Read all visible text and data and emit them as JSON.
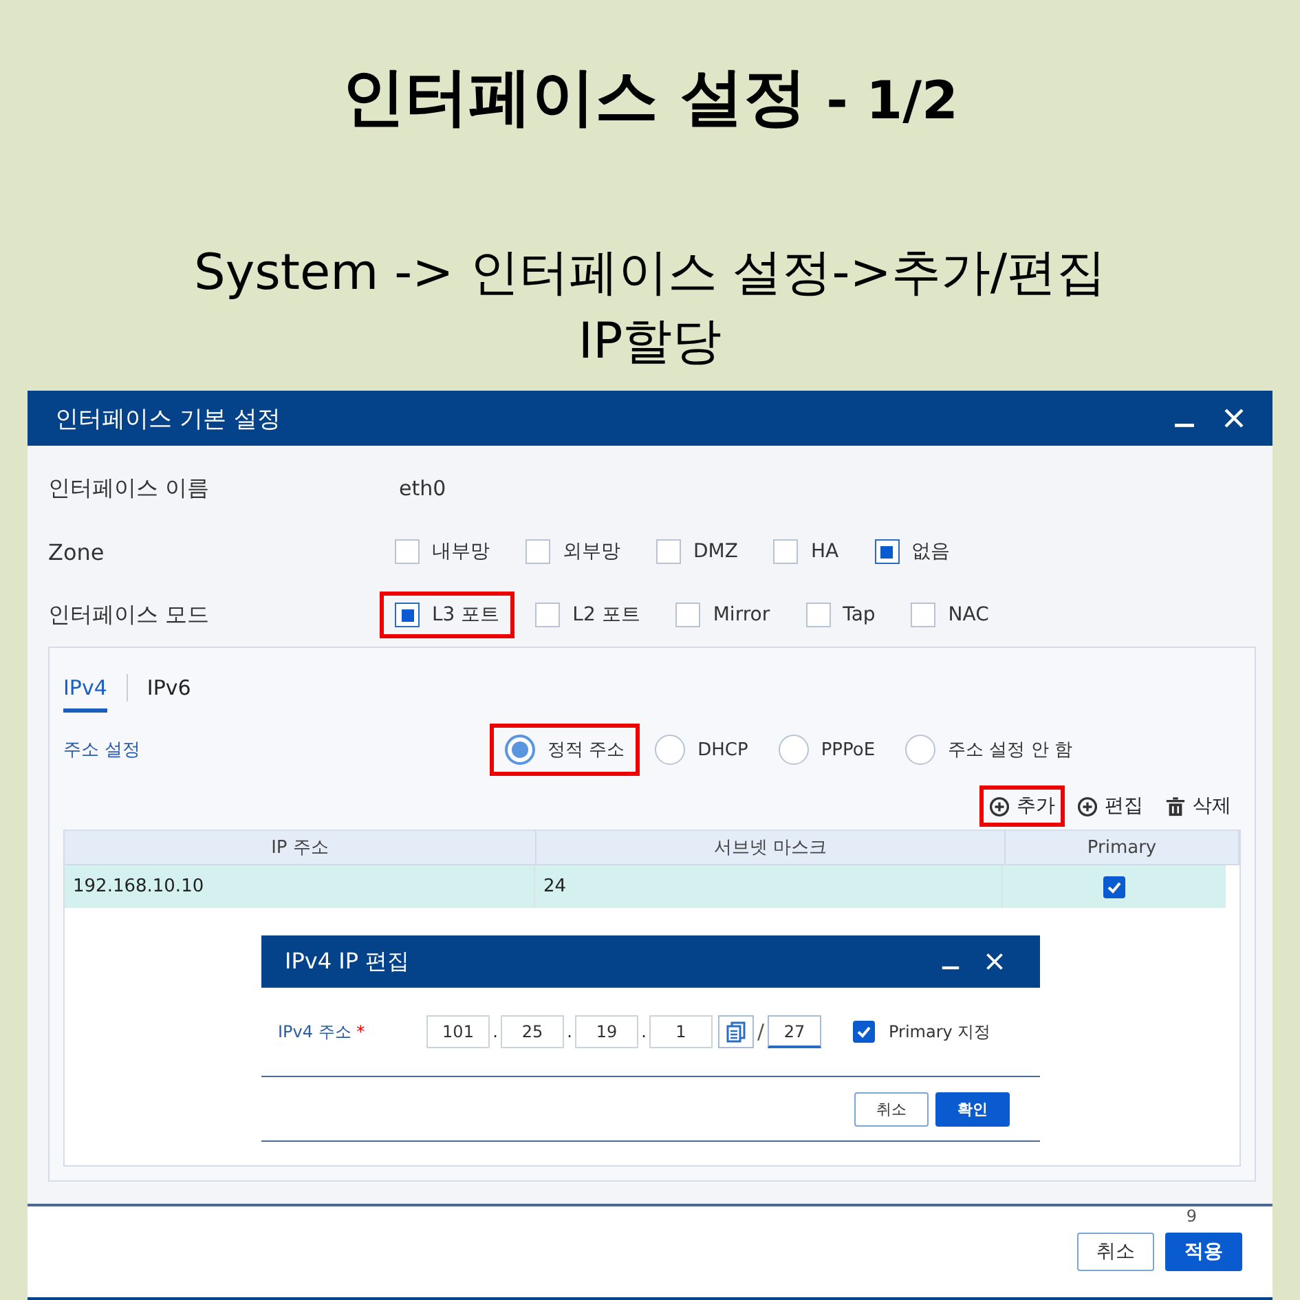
{
  "slide": {
    "title": "인터페이스 설정",
    "title_suffix": "- 1/2",
    "subtitle_lines": [
      "System -> 인터페이스 설정->추가/편집",
      "IP할당"
    ],
    "page_number": "9"
  },
  "dialog": {
    "title": "인터페이스 기본 설정",
    "fields": [
      {
        "kind": "text",
        "label": "인터페이스 이름",
        "value": "eth0"
      },
      {
        "kind": "checkboxes",
        "label": "Zone",
        "options": [
          {
            "label": "내부망",
            "checked": false,
            "highlighted": false
          },
          {
            "label": "외부망",
            "checked": false,
            "highlighted": false
          },
          {
            "label": "DMZ",
            "checked": false,
            "highlighted": false
          },
          {
            "label": "HA",
            "checked": false,
            "highlighted": false
          },
          {
            "label": "없음",
            "checked": true,
            "highlighted": false
          }
        ]
      },
      {
        "kind": "checkboxes",
        "label": "인터페이스 모드",
        "options": [
          {
            "label": "L3 포트",
            "checked": true,
            "highlighted": true
          },
          {
            "label": "L2 포트",
            "checked": false,
            "highlighted": false
          },
          {
            "label": "Mirror",
            "checked": false,
            "highlighted": false
          },
          {
            "label": "Tap",
            "checked": false,
            "highlighted": false
          },
          {
            "label": "NAC",
            "checked": false,
            "highlighted": false
          }
        ]
      }
    ],
    "tabs": [
      {
        "label": "IPv4",
        "selected": true
      },
      {
        "label": "IPv6",
        "selected": false
      }
    ],
    "address_setting": {
      "label": "주소 설정",
      "options": [
        {
          "label": "정적 주소",
          "selected": true,
          "highlighted": true
        },
        {
          "label": "DHCP",
          "selected": false,
          "highlighted": false
        },
        {
          "label": "PPPoE",
          "selected": false,
          "highlighted": false
        },
        {
          "label": "주소 설정 안 함",
          "selected": false,
          "highlighted": false
        }
      ]
    },
    "toolbar": [
      {
        "kind": "add",
        "label": "추가",
        "highlighted": true
      },
      {
        "kind": "edit",
        "label": "편집",
        "highlighted": false
      },
      {
        "kind": "delete",
        "label": "삭제",
        "highlighted": false
      }
    ],
    "table": {
      "columns": [
        "IP 주소",
        "서브넷 마스크",
        "Primary"
      ],
      "rows": [
        {
          "ip": "192.168.10.10",
          "mask": "24",
          "primary": true,
          "selected": true
        }
      ]
    },
    "edit_dialog": {
      "title": "IPv4 IP 편집",
      "label": "IPv4 주소",
      "required_mark": "*",
      "octets": [
        "101",
        "25",
        "19",
        "1"
      ],
      "separator": ".",
      "prefix_separator": "/",
      "prefix": "27",
      "primary": {
        "label": "Primary 지정",
        "checked": true
      },
      "buttons": [
        {
          "label": "취소",
          "primary": false
        },
        {
          "label": "확인",
          "primary": true
        }
      ]
    },
    "buttons": [
      {
        "label": "취소",
        "primary": false
      },
      {
        "label": "적용",
        "primary": true
      }
    ]
  }
}
